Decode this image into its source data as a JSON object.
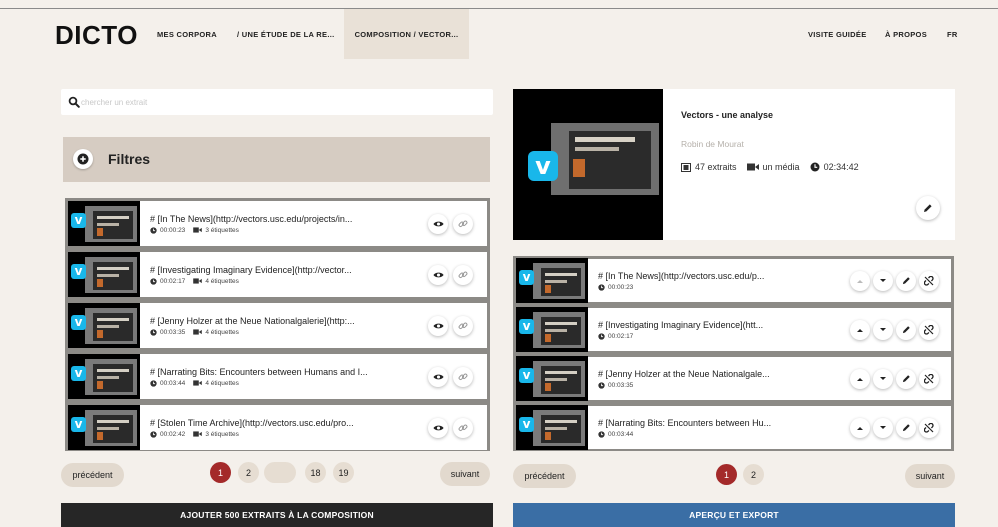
{
  "app": {
    "logo": "DICTO",
    "nav": {
      "mes_corpora": "MES CORPORA",
      "etude": "/ UNE ÉTUDE DE LA RE...",
      "composition": "COMPOSITION / VECTOR...",
      "visite": "VISITE GUIDÉE",
      "apropos": "À PROPOS",
      "lang": "FR"
    }
  },
  "search": {
    "placeholder": "chercher un extrait"
  },
  "filters": {
    "label": "Filtres"
  },
  "left_list": {
    "items": [
      {
        "title": "# [In The News](http://vectors.usc.edu/projects/in...",
        "time": "00:00:23",
        "tags": "3 étiquettes"
      },
      {
        "title": "# [Investigating Imaginary Evidence](http://vector...",
        "time": "00:02:17",
        "tags": "4 étiquettes"
      },
      {
        "title": "# [Jenny Holzer at the Neue Nationalgalerie](http:...",
        "time": "00:03:35",
        "tags": "4 étiquettes"
      },
      {
        "title": "# [Narrating Bits: Encounters between Humans and I...",
        "time": "00:03:44",
        "tags": "4 étiquettes"
      },
      {
        "title": "# [Stolen Time Archive](http://vectors.usc.edu/pro...",
        "time": "00:02:42",
        "tags": "3 étiquettes"
      }
    ],
    "pagination": {
      "prev": "précédent",
      "next": "suivant",
      "pages": [
        "1",
        "2",
        "...",
        "18",
        "19"
      ],
      "active": "1"
    },
    "action_button": "AJOUTER 500 EXTRAITS À LA COMPOSITION"
  },
  "composition": {
    "title": "Vectors - une analyse",
    "author": "Robin de Mourat",
    "extracts": "47 extraits",
    "media": "un média",
    "duration": "02:34:42"
  },
  "right_list": {
    "items": [
      {
        "title": "# [In The News](http://vectors.usc.edu/p...",
        "time": "00:00:23"
      },
      {
        "title": "# [Investigating Imaginary Evidence](htt...",
        "time": "00:02:17"
      },
      {
        "title": "# [Jenny Holzer at the Neue Nationalgale...",
        "time": "00:03:35"
      },
      {
        "title": "# [Narrating Bits: Encounters between Hu...",
        "time": "00:03:44"
      }
    ],
    "pagination": {
      "prev": "précédent",
      "next": "suivant",
      "pages": [
        "1",
        "2"
      ],
      "active": "1"
    },
    "action_button": "APERÇU ET EXPORT"
  },
  "colors": {
    "accent_red": "#a42a2a",
    "export_blue": "#3a6ea5",
    "dark": "#262626",
    "beige": "#d6ccc2"
  },
  "icons": [
    "search-icon",
    "plus-circle-icon",
    "clock-icon",
    "video-icon",
    "film-icon",
    "eye-icon",
    "link-icon",
    "chevron-up-icon",
    "chevron-down-icon",
    "pencil-icon",
    "unlink-icon",
    "vimeo-logo-icon"
  ]
}
